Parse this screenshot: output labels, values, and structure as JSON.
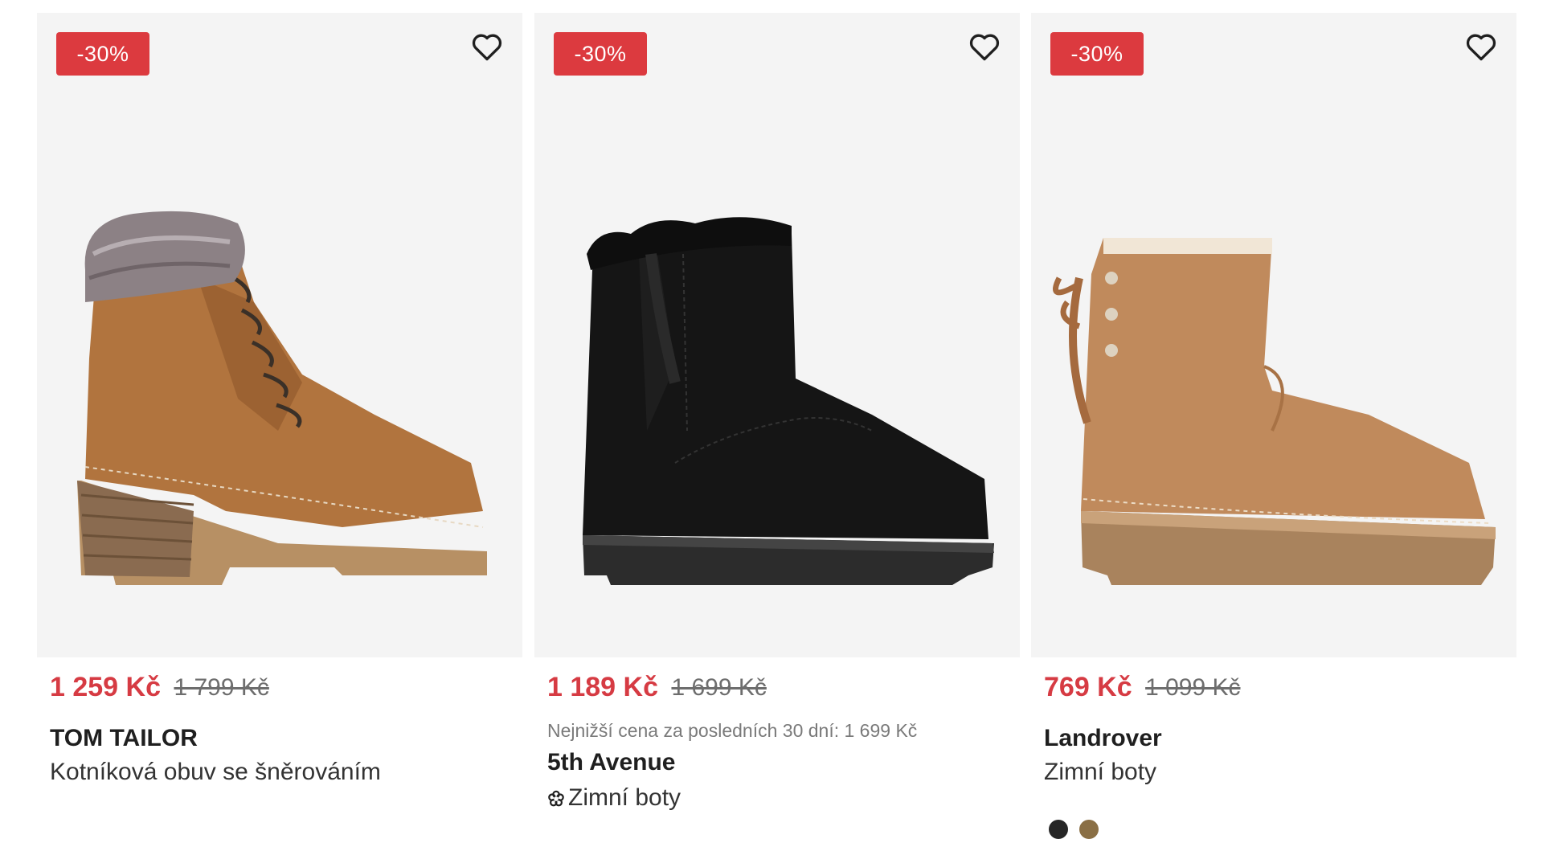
{
  "products": [
    {
      "discount_badge": "-30%",
      "price_new": "1 259 Kč",
      "price_old": "1 799 Kč",
      "brand": "TOM TAILOR",
      "name": "Kotníková obuv se šněrováním",
      "image": "brown-lace-up-ankle-boot-with-fur-collar",
      "favorite_icon": "heart-outline-icon"
    },
    {
      "discount_badge": "-30%",
      "price_new": "1 189 Kč",
      "price_old": "1 699 Kč",
      "lowest_price_note": "Nejnižší cena za posledních 30 dní: 1 699 Kč",
      "brand": "5th Avenue",
      "name": "Zimní boty",
      "name_icon": "eco-flower-icon",
      "image": "black-suede-winter-boot-with-fur",
      "favorite_icon": "heart-outline-icon"
    },
    {
      "discount_badge": "-30%",
      "price_new": "769 Kč",
      "price_old": "1 099 Kč",
      "brand": "Landrover",
      "name": "Zimní boty",
      "image": "tan-winter-boot-with-back-lace",
      "favorite_icon": "heart-outline-icon",
      "color_swatches": [
        "#262626",
        "#8a6f45"
      ]
    }
  ],
  "colors": {
    "badge": "#dc3a3f",
    "price_new": "#d63b43",
    "image_bg": "#f4f4f4"
  }
}
